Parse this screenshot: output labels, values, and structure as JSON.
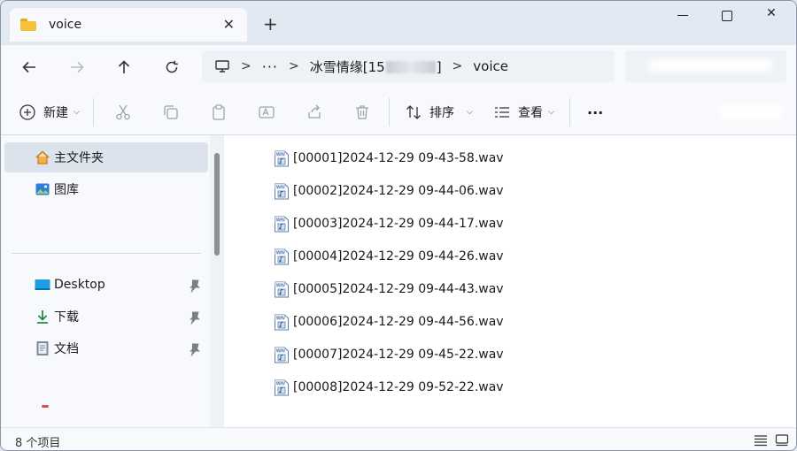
{
  "tab": {
    "title": "voice",
    "close": "✕",
    "new_tab": "+"
  },
  "window_controls": {
    "close": "✕"
  },
  "address": {
    "segment_1": "冰雪情缘[15",
    "segment_1_tail": "]",
    "overflow": "···",
    "sep": ">",
    "current": "voice"
  },
  "toolbar": {
    "new_label": "新建",
    "sort_label": "排序",
    "view_label": "查看",
    "more": "···"
  },
  "sidebar": {
    "home": "主文件夹",
    "gallery": "图库",
    "desktop": "Desktop",
    "downloads": "下载",
    "documents": "文档"
  },
  "files": [
    "[00001]2024-12-29 09-43-58.wav",
    "[00002]2024-12-29 09-44-06.wav",
    "[00003]2024-12-29 09-44-17.wav",
    "[00004]2024-12-29 09-44-26.wav",
    "[00005]2024-12-29 09-44-43.wav",
    "[00006]2024-12-29 09-44-56.wav",
    "[00007]2024-12-29 09-45-22.wav",
    "[00008]2024-12-29 09-52-22.wav"
  ],
  "status": {
    "item_count": "8 个项目"
  },
  "colors": {
    "accent": "#0067c0",
    "folder": "#f6c13a",
    "selection": "#dde3ec"
  }
}
